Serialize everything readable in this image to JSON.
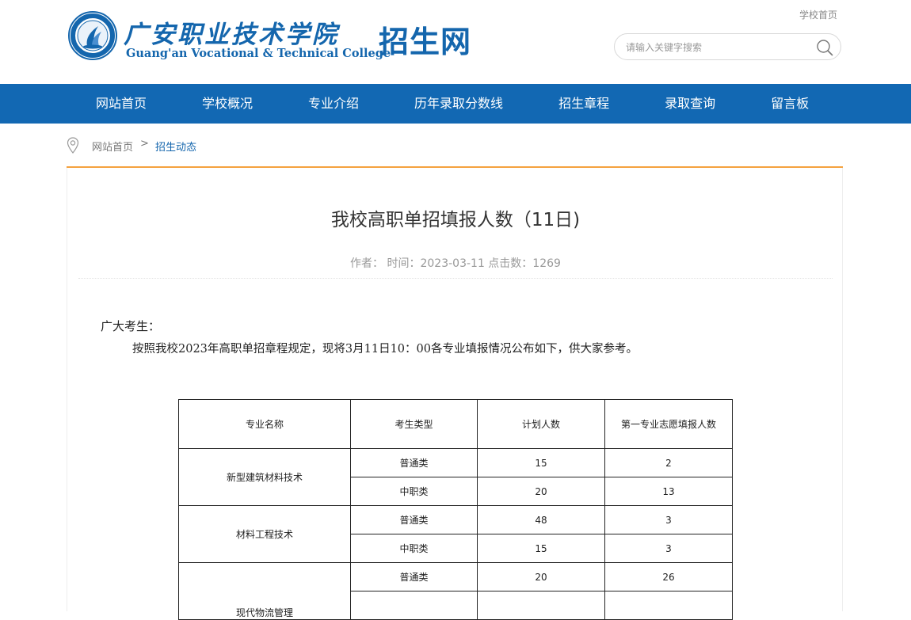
{
  "header": {
    "college_name_cn": "广安职业技术学院",
    "college_name_en": "Guang'an Vocational & Technical College",
    "site_name": "招生网",
    "school_home_link": "学校首页",
    "search_placeholder": "请输入关键字搜索",
    "brand_color": "#1466ad"
  },
  "nav": {
    "color": "#1268b3",
    "items": [
      {
        "label": "网站首页"
      },
      {
        "label": "学校概况"
      },
      {
        "label": "专业介绍"
      },
      {
        "label": "历年录取分数线"
      },
      {
        "label": "招生章程"
      },
      {
        "label": "录取查询"
      },
      {
        "label": "留言板"
      }
    ]
  },
  "breadcrumb": {
    "home": "网站首页",
    "separator": ">",
    "current": "招生动态"
  },
  "article": {
    "title": "我校高职单招填报人数（11日)",
    "meta": "作者： 时间：2023-03-11 点击数：1269",
    "greeting": "广大考生：",
    "paragraph": "按照我校2023年高职单招章程规定，现将3月11日10：00各专业填报情况公布如下，供大家参考。"
  },
  "table": {
    "headers": [
      "专业名称",
      "考生类型",
      "计划人数",
      "第一专业志愿填报人数"
    ],
    "majors": [
      {
        "name": "新型建筑材料技术",
        "rows": [
          {
            "type": "普通类",
            "plan": "15",
            "applicants": "2"
          },
          {
            "type": "中职类",
            "plan": "20",
            "applicants": "13"
          }
        ]
      },
      {
        "name": "材料工程技术",
        "rows": [
          {
            "type": "普通类",
            "plan": "48",
            "applicants": "3"
          },
          {
            "type": "中职类",
            "plan": "15",
            "applicants": "3"
          }
        ]
      },
      {
        "name": "现代物流管理",
        "rows": [
          {
            "type": "普通类",
            "plan": "20",
            "applicants": "26"
          }
        ]
      }
    ]
  }
}
